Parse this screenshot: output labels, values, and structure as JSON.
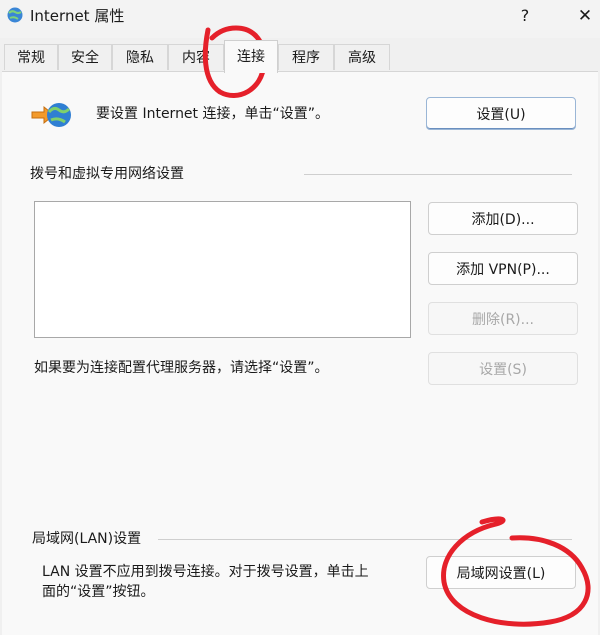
{
  "window": {
    "title": "Internet 属性",
    "help": "?",
    "close": "✕"
  },
  "tabs": [
    {
      "label": "常规"
    },
    {
      "label": "安全"
    },
    {
      "label": "隐私"
    },
    {
      "label": "内容"
    },
    {
      "label": "连接",
      "active": true
    },
    {
      "label": "程序"
    },
    {
      "label": "高级"
    }
  ],
  "setup": {
    "text": "要设置 Internet 连接，单击“设置”。",
    "button": "设置(U)"
  },
  "dialup": {
    "header": "拨号和虚拟专用网络设置",
    "add": "添加(D)...",
    "add_vpn": "添加 VPN(P)...",
    "remove": "删除(R)...",
    "settings": "设置(S)",
    "proxy_text": "如果要为连接配置代理服务器，请选择“设置”。"
  },
  "lan": {
    "header": "局域网(LAN)设置",
    "text_line1": "LAN 设置不应用到拨号连接。对于拨号设置，单击上",
    "text_line2": "面的“设置”按钮。",
    "button": "局域网设置(L)"
  },
  "colors": {
    "annotation": "#e5202a",
    "primary_border": "#9ab6d6"
  }
}
